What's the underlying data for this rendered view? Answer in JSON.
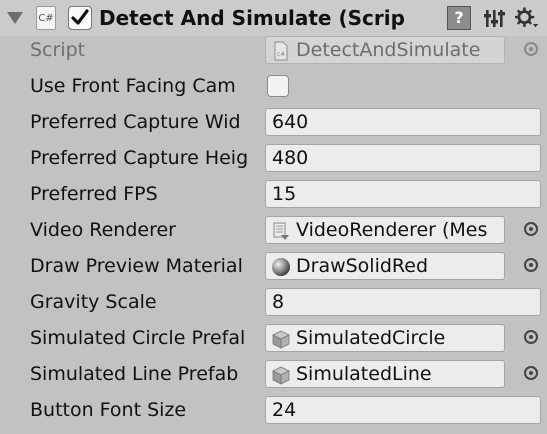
{
  "component": {
    "title": "Detect And Simulate (Scrip",
    "cs_icon_text": "C#",
    "enabled": true,
    "help_icon_text": "?"
  },
  "fields": {
    "script": {
      "label": "Script",
      "value": "DetectAndSimulate"
    },
    "use_front_facing_cam": {
      "label": "Use Front Facing Cam",
      "checked": false
    },
    "preferred_capture_width": {
      "label": "Preferred Capture Wid",
      "value": "640"
    },
    "preferred_capture_height": {
      "label": "Preferred Capture Heig",
      "value": "480"
    },
    "preferred_fps": {
      "label": "Preferred FPS",
      "value": "15"
    },
    "video_renderer": {
      "label": "Video Renderer",
      "value": "VideoRenderer (Mes"
    },
    "draw_preview_material": {
      "label": "Draw Preview Material",
      "value": "DrawSolidRed"
    },
    "gravity_scale": {
      "label": "Gravity Scale",
      "value": "8"
    },
    "simulated_circle_prefab": {
      "label": "Simulated Circle Prefal",
      "value": "SimulatedCircle"
    },
    "simulated_line_prefab": {
      "label": "Simulated Line Prefab",
      "value": "SimulatedLine"
    },
    "button_font_size": {
      "label": "Button Font Size",
      "value": "24"
    }
  }
}
